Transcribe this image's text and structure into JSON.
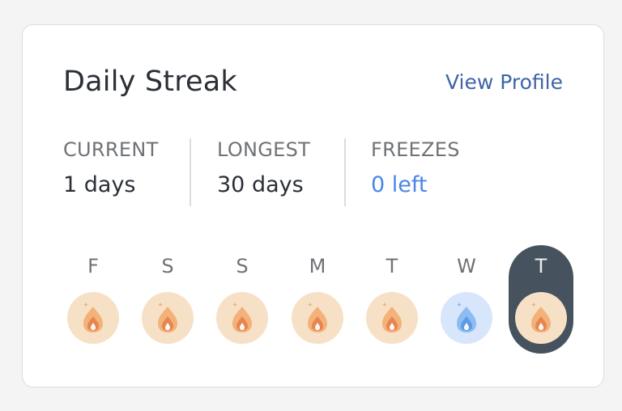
{
  "card": {
    "title": "Daily Streak",
    "view_profile_label": "View Profile"
  },
  "stats": [
    {
      "label": "CURRENT",
      "value": "1 days"
    },
    {
      "label": "LONGEST",
      "value": "30 days"
    },
    {
      "label": "FREEZES",
      "value": "0 left"
    }
  ],
  "days": [
    {
      "letter": "F",
      "state": "fire",
      "icon": "flame-icon"
    },
    {
      "letter": "S",
      "state": "fire",
      "icon": "flame-icon"
    },
    {
      "letter": "S",
      "state": "fire",
      "icon": "flame-icon"
    },
    {
      "letter": "M",
      "state": "fire",
      "icon": "flame-icon"
    },
    {
      "letter": "T",
      "state": "fire",
      "icon": "flame-icon"
    },
    {
      "letter": "W",
      "state": "freeze",
      "icon": "frozen-flame-icon"
    },
    {
      "letter": "T",
      "state": "fire",
      "icon": "flame-icon",
      "today": true
    }
  ],
  "colors": {
    "fire_badge": "#f7e1c6",
    "freeze_badge": "#d7e6fb",
    "today_pill": "#46535f",
    "link": "#3f65a6",
    "freeze_value": "#4a86e8"
  }
}
